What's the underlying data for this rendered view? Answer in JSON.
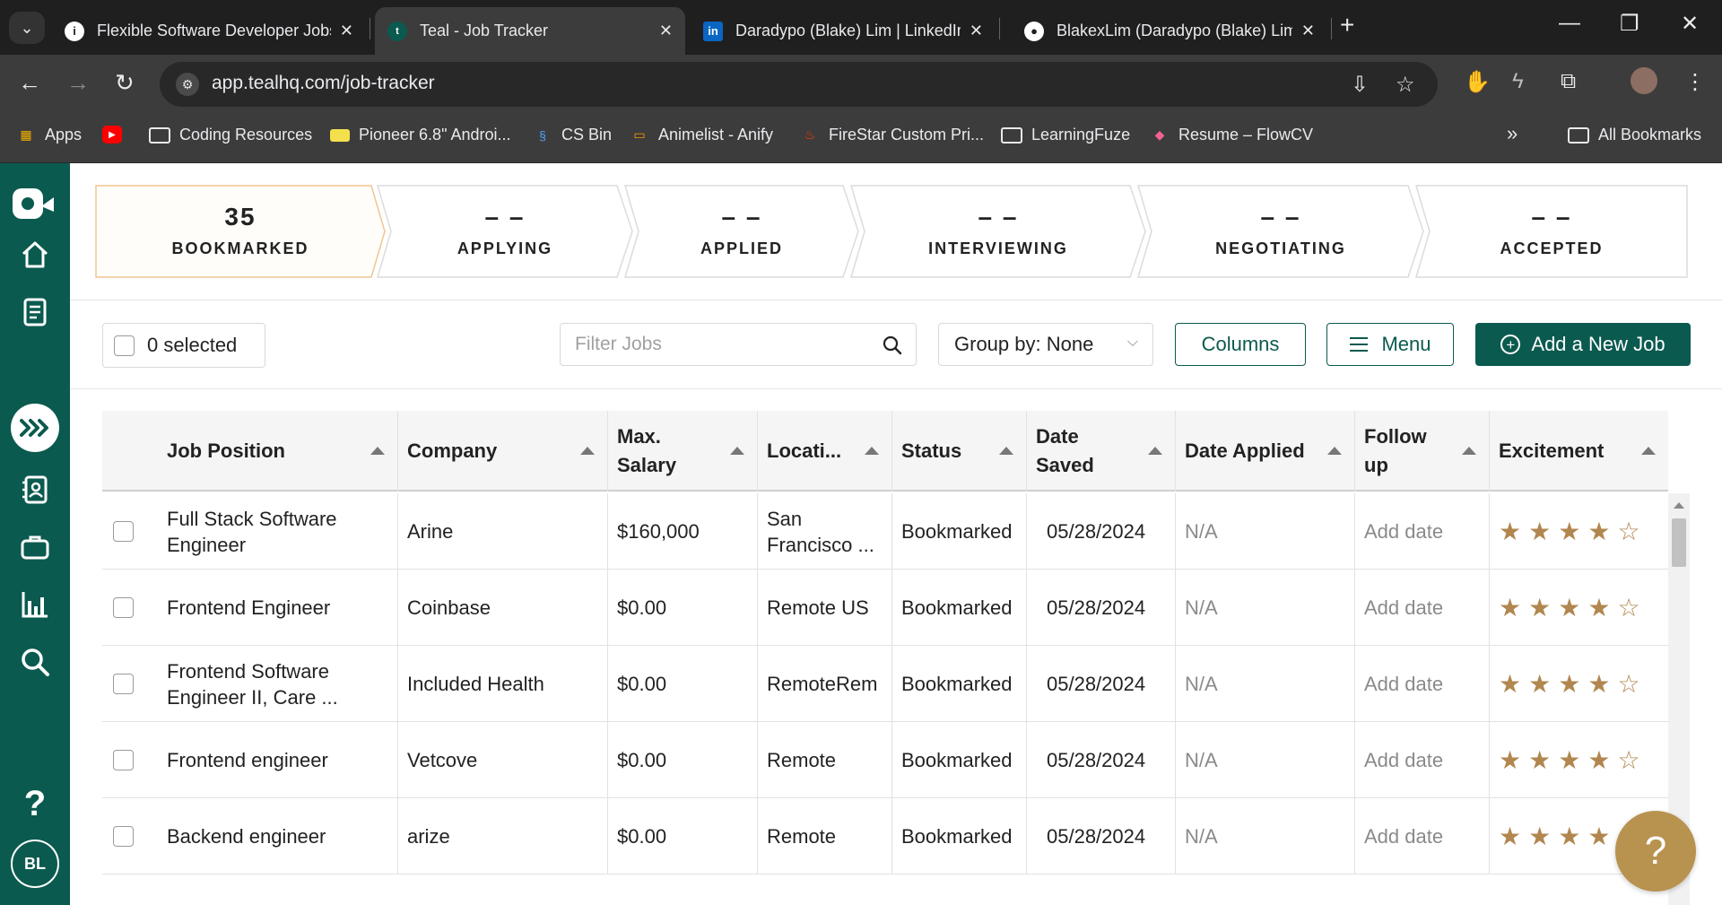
{
  "browser": {
    "tabs": [
      {
        "title": "Flexible Software Developer Jobs",
        "favicon": "info-icon"
      },
      {
        "title": "Teal - Job Tracker",
        "favicon": "teal-icon"
      },
      {
        "title": "Daradypo (Blake) Lim | LinkedIn",
        "favicon": "linkedin-icon"
      },
      {
        "title": "BlakexLim (Daradypo (Blake) Lim)",
        "favicon": "github-icon"
      }
    ],
    "url": "app.tealhq.com/job-tracker",
    "bookmarks": [
      {
        "label": "Apps",
        "icon": "apps-grid-icon"
      },
      {
        "label": "",
        "icon": "youtube-icon"
      },
      {
        "label": "Coding Resources",
        "icon": "folder-icon"
      },
      {
        "label": "Pioneer 6.8\" Androi...",
        "icon": "tag-icon"
      },
      {
        "label": "CS Bin",
        "icon": "csbin-icon"
      },
      {
        "label": "Animelist - Anify",
        "icon": "anify-icon"
      },
      {
        "label": "FireStar Custom Pri...",
        "icon": "flame-icon"
      },
      {
        "label": "LearningFuze",
        "icon": "folder-icon"
      },
      {
        "label": "Resume – FlowCV",
        "icon": "flowcv-icon"
      }
    ],
    "more_bookmarks": "»",
    "all_bookmarks": "All Bookmarks"
  },
  "sidebar": {
    "items": [
      "home-icon",
      "resume-icon",
      "job-tracker-icon",
      "contacts-icon",
      "briefcase-icon",
      "analytics-icon",
      "search-icon"
    ],
    "help": "?",
    "avatar_initials": "BL"
  },
  "pipeline": {
    "stages": [
      {
        "count": "35",
        "label": "BOOKMARKED"
      },
      {
        "count": "– –",
        "label": "APPLYING"
      },
      {
        "count": "– –",
        "label": "APPLIED"
      },
      {
        "count": "– –",
        "label": "INTERVIEWING"
      },
      {
        "count": "– –",
        "label": "NEGOTIATING"
      },
      {
        "count": "– –",
        "label": "ACCEPTED"
      }
    ]
  },
  "controls": {
    "selected_label": "0 selected",
    "filter_placeholder": "Filter Jobs",
    "group_by": "Group by: None",
    "columns_label": "Columns",
    "menu_label": "Menu",
    "add_job_label": "Add a New Job"
  },
  "table": {
    "columns": [
      "Job Position",
      "Company",
      "Max. Salary",
      "Locati...",
      "Status",
      "Date Saved",
      "Date Applied",
      "Follow up",
      "Excitement"
    ],
    "rows": [
      {
        "position": "Full Stack Software Engineer",
        "company": "Arine",
        "salary": "$160,000",
        "location": "San Francisco ...",
        "status": "Bookmarked",
        "date_saved": "05/28/2024",
        "date_applied": "N/A",
        "follow_up": "Add date",
        "excitement": 4
      },
      {
        "position": "Frontend Engineer",
        "company": "Coinbase",
        "salary": "$0.00",
        "location": "Remote US",
        "status": "Bookmarked",
        "date_saved": "05/28/2024",
        "date_applied": "N/A",
        "follow_up": "Add date",
        "excitement": 4
      },
      {
        "position": "Frontend Software Engineer II, Care ...",
        "company": "Included Health",
        "salary": "$0.00",
        "location": "RemoteRem",
        "status": "Bookmarked",
        "date_saved": "05/28/2024",
        "date_applied": "N/A",
        "follow_up": "Add date",
        "excitement": 4
      },
      {
        "position": "Frontend engineer",
        "company": "Vetcove",
        "salary": "$0.00",
        "location": "Remote",
        "status": "Bookmarked",
        "date_saved": "05/28/2024",
        "date_applied": "N/A",
        "follow_up": "Add date",
        "excitement": 4
      },
      {
        "position": "Backend engineer",
        "company": "arize",
        "salary": "$0.00",
        "location": "Remote",
        "status": "Bookmarked",
        "date_saved": "05/28/2024",
        "date_applied": "N/A",
        "follow_up": "Add date",
        "excitement": 4
      }
    ],
    "max_stars": 5
  },
  "help_bubble": "?",
  "colors": {
    "brand": "#0b5a4f",
    "star": "#b1874f",
    "help": "#b8924f"
  }
}
